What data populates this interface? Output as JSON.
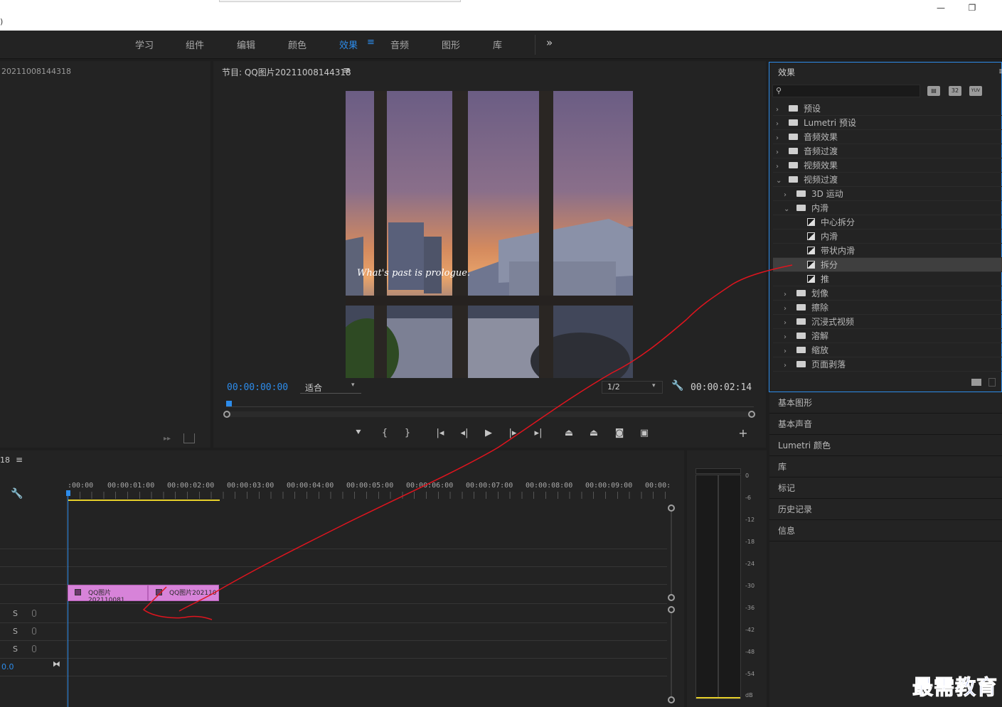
{
  "window": {
    "paren": ")",
    "min_icon": "minimize-icon",
    "max_icon": "restore-icon",
    "close_icon": "close-icon"
  },
  "workspaces": {
    "items": [
      "学习",
      "组件",
      "编辑",
      "颜色",
      "效果",
      "音频",
      "图形",
      "库"
    ],
    "active": "效果",
    "more": "»"
  },
  "source_panel": {
    "title": "20211008144318"
  },
  "program": {
    "title": "节目: QQ图片20211008144318",
    "menu": "≡",
    "timecode_current": "00:00:00:00",
    "fit_label": "适合",
    "resolution": "1/2",
    "timecode_duration": "00:00:02:14",
    "overlay_text": "What's past is prologue."
  },
  "effects_panel": {
    "title": "效果",
    "menu": "≡",
    "search_placeholder": "",
    "badges": [
      "32",
      "YUV"
    ],
    "tree": [
      {
        "label": "预设",
        "indent": 0,
        "type": "folder",
        "expanded": false
      },
      {
        "label": "Lumetri 预设",
        "indent": 0,
        "type": "folder",
        "expanded": false
      },
      {
        "label": "音频效果",
        "indent": 0,
        "type": "folder",
        "expanded": false
      },
      {
        "label": "音频过渡",
        "indent": 0,
        "type": "folder",
        "expanded": false
      },
      {
        "label": "视频效果",
        "indent": 0,
        "type": "folder",
        "expanded": false
      },
      {
        "label": "视频过渡",
        "indent": 0,
        "type": "folder",
        "expanded": true
      },
      {
        "label": "3D 运动",
        "indent": 1,
        "type": "folder",
        "expanded": false
      },
      {
        "label": "内滑",
        "indent": 1,
        "type": "folder",
        "expanded": true
      },
      {
        "label": "中心拆分",
        "indent": 2,
        "type": "effect"
      },
      {
        "label": "内滑",
        "indent": 2,
        "type": "effect"
      },
      {
        "label": "带状内滑",
        "indent": 2,
        "type": "effect"
      },
      {
        "label": "拆分",
        "indent": 2,
        "type": "effect",
        "selected": true
      },
      {
        "label": "推",
        "indent": 2,
        "type": "effect"
      },
      {
        "label": "划像",
        "indent": 1,
        "type": "folder",
        "expanded": false
      },
      {
        "label": "擦除",
        "indent": 1,
        "type": "folder",
        "expanded": false
      },
      {
        "label": "沉浸式视频",
        "indent": 1,
        "type": "folder",
        "expanded": false
      },
      {
        "label": "溶解",
        "indent": 1,
        "type": "folder",
        "expanded": false
      },
      {
        "label": "缩放",
        "indent": 1,
        "type": "folder",
        "expanded": false
      },
      {
        "label": "页面剥落",
        "indent": 1,
        "type": "folder",
        "expanded": false
      }
    ]
  },
  "right_panels": [
    "基本图形",
    "基本声音",
    "Lumetri 颜色",
    "库",
    "标记",
    "历史记录",
    "信息"
  ],
  "timeline": {
    "title": "18",
    "menu": "≡",
    "ruler": [
      ":00:00",
      "00:00:01:00",
      "00:00:02:00",
      "00:00:03:00",
      "00:00:04:00",
      "00:00:05:00",
      "00:00:06:00",
      "00:00:07:00",
      "00:00:08:00",
      "00:00:09:00",
      "00:00:"
    ],
    "clips": [
      "QQ图片202110081",
      "QQ图片202110"
    ],
    "audio_tracks": [
      "S",
      "S",
      "S"
    ],
    "master_value": "0.0"
  },
  "meter": {
    "labels": [
      "0",
      "-6",
      "-12",
      "-18",
      "-24",
      "-30",
      "-36",
      "-42",
      "-48",
      "-54",
      "dB"
    ]
  },
  "watermark": "最需教育",
  "colors": {
    "accent": "#2d8ceb",
    "clip": "#d783d9",
    "annotation": "#e0141e",
    "work_area": "#e6d02a"
  }
}
